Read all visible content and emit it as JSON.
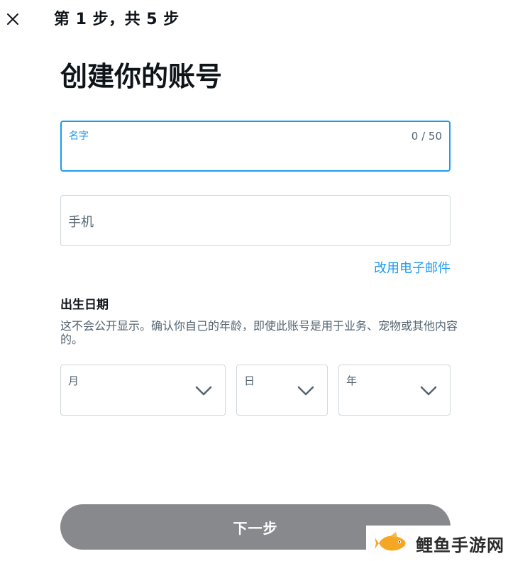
{
  "header": {
    "close_icon": "close-icon",
    "step_text": "第 1 步，共 5 步"
  },
  "page": {
    "title": "创建你的账号"
  },
  "form": {
    "name": {
      "label": "名字",
      "counter": "0 / 50",
      "value": ""
    },
    "phone": {
      "placeholder": "手机"
    },
    "use_email_link": "改用电子邮件"
  },
  "dob": {
    "heading": "出生日期",
    "description": "这不会公开显示。确认你自己的年龄，即使此账号是用于业务、宠物或其他内容的。",
    "month_label": "月",
    "day_label": "日",
    "year_label": "年",
    "chevron_icon": "chevron-down-icon"
  },
  "footer": {
    "next_label": "下一步",
    "next_button_color": "#87898c"
  },
  "watermark": {
    "text": "鲤鱼手游网",
    "icon": "fish-logo-icon"
  },
  "colors": {
    "accent": "#1d9bf0",
    "border": "#cfd9de",
    "text": "#0f1419",
    "muted": "#536471"
  }
}
